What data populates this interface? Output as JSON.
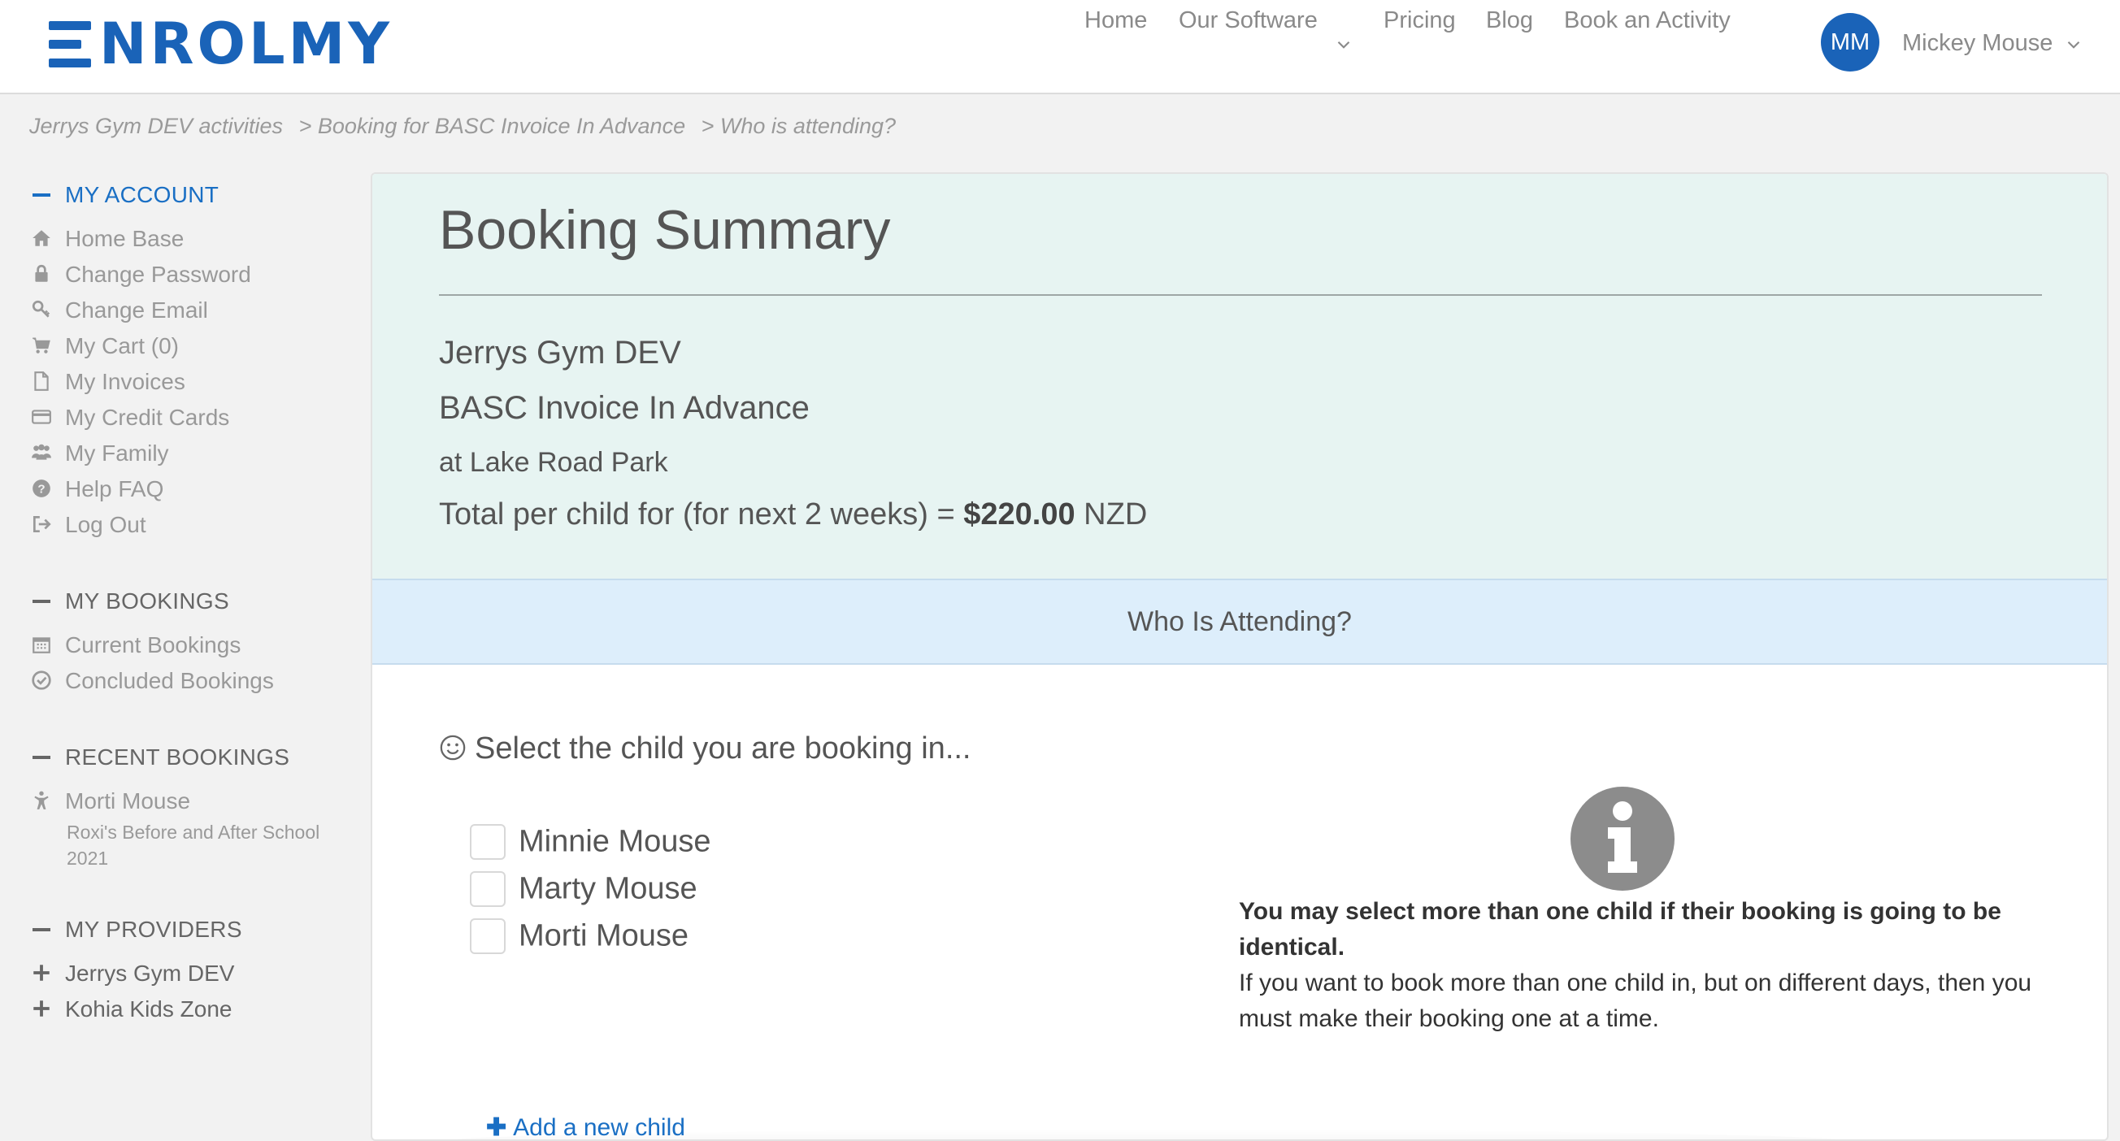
{
  "header": {
    "logo_text": "ENROLMY",
    "nav": {
      "home": "Home",
      "our_software": "Our Software",
      "pricing": "Pricing",
      "blog": "Blog",
      "book_activity": "Book an Activity"
    },
    "avatar_initials": "MM",
    "user_name": "Mickey Mouse"
  },
  "breadcrumb": [
    "Jerrys Gym DEV activities",
    "> Booking for BASC Invoice In Advance",
    "> Who is attending?"
  ],
  "sidebar": {
    "my_account": {
      "heading": "MY ACCOUNT",
      "items": [
        {
          "label": "Home Base",
          "icon": "home-icon"
        },
        {
          "label": "Change Password",
          "icon": "lock-icon"
        },
        {
          "label": "Change Email",
          "icon": "key-icon"
        },
        {
          "label": "My Cart (0)",
          "icon": "cart-icon"
        },
        {
          "label": "My Invoices",
          "icon": "document-icon"
        },
        {
          "label": "My Credit Cards",
          "icon": "credit-card-icon"
        },
        {
          "label": "My Family",
          "icon": "family-icon"
        },
        {
          "label": "Help FAQ",
          "icon": "help-icon"
        },
        {
          "label": "Log Out",
          "icon": "logout-icon"
        }
      ]
    },
    "my_bookings": {
      "heading": "MY BOOKINGS",
      "items": [
        {
          "label": "Current Bookings",
          "icon": "calendar-icon"
        },
        {
          "label": "Concluded Bookings",
          "icon": "check-circle-icon"
        }
      ]
    },
    "recent_bookings": {
      "heading": "RECENT BOOKINGS",
      "child": "Morti Mouse",
      "detail": "Roxi's Before and After School 2021"
    },
    "my_providers": {
      "heading": "MY PROVIDERS",
      "items": [
        {
          "label": "Jerrys Gym DEV",
          "icon": "plus-icon"
        },
        {
          "label": "Kohia Kids Zone",
          "icon": "plus-icon"
        }
      ]
    }
  },
  "summary": {
    "title": "Booking Summary",
    "provider": "Jerrys Gym DEV",
    "activity": "BASC Invoice In Advance",
    "location": "at Lake Road Park",
    "total_prefix": "Total per child for (for next 2 weeks) =",
    "total_amount": "$220.00",
    "currency": "NZD"
  },
  "attending": {
    "heading": "Who Is Attending?",
    "prompt": "Select the child you are booking in...",
    "children": [
      "Minnie Mouse",
      "Marty Mouse",
      "Morti Mouse"
    ],
    "info_bold": "You may select more than one child if their booking is going to be identical.",
    "info_text": "If you want to book more than one child in, but on different days, then you must make their booking one at a time.",
    "add_child": "Add a new child"
  },
  "colors": {
    "brand_blue": "#1a63b8",
    "link_blue": "#1a6fc4",
    "summary_bg": "#e7f4f2",
    "attending_bg": "#ddeefb"
  }
}
